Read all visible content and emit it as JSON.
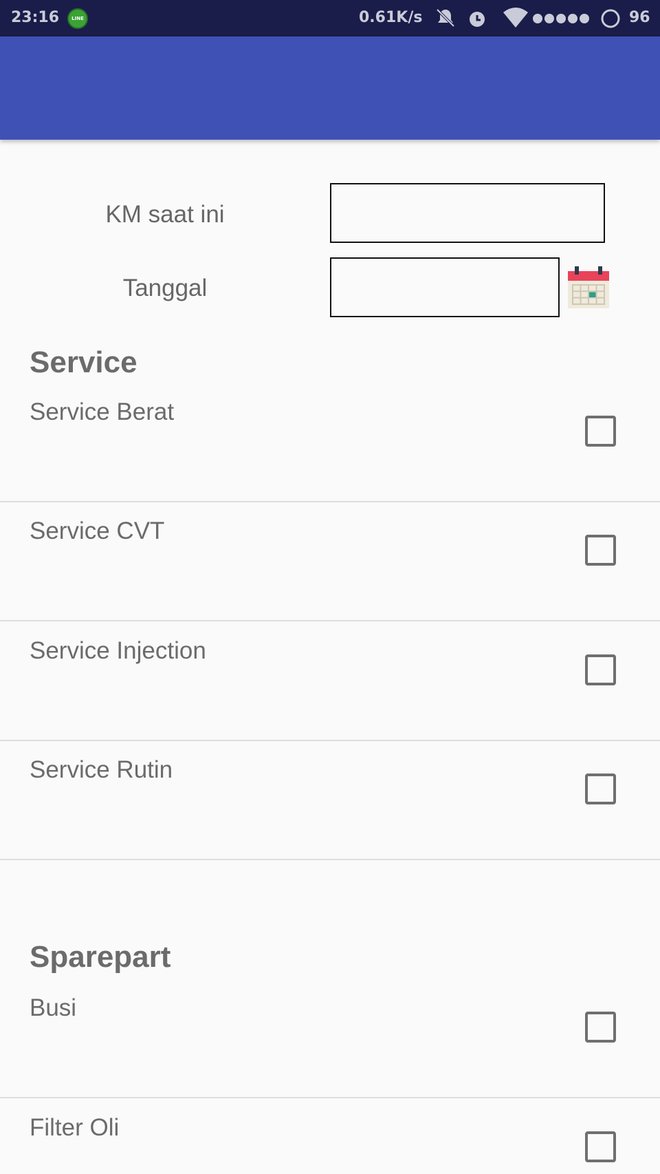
{
  "status_bar": {
    "time": "23:16",
    "notification_icon": "line-app-icon",
    "network_speed": "0.61K/s",
    "icons": [
      "mute-icon",
      "alarm-icon",
      "wifi-icon",
      "signal-dots-icon",
      "battery-ring-icon"
    ],
    "battery": "96"
  },
  "app_bar": {
    "color": "#3f51b5"
  },
  "form": {
    "km_label": "KM saat ini",
    "km_value": "",
    "date_label": "Tanggal",
    "date_value": "",
    "calendar_icon": "calendar-icon"
  },
  "service": {
    "title": "Service",
    "items": [
      {
        "label": "Service Berat",
        "checked": false
      },
      {
        "label": "Service CVT",
        "checked": false
      },
      {
        "label": "Service Injection",
        "checked": false
      },
      {
        "label": "Service Rutin",
        "checked": false
      }
    ]
  },
  "sparepart": {
    "title": "Sparepart",
    "items": [
      {
        "label": "Busi",
        "checked": false
      },
      {
        "label": "Filter Oli",
        "checked": false
      }
    ]
  }
}
